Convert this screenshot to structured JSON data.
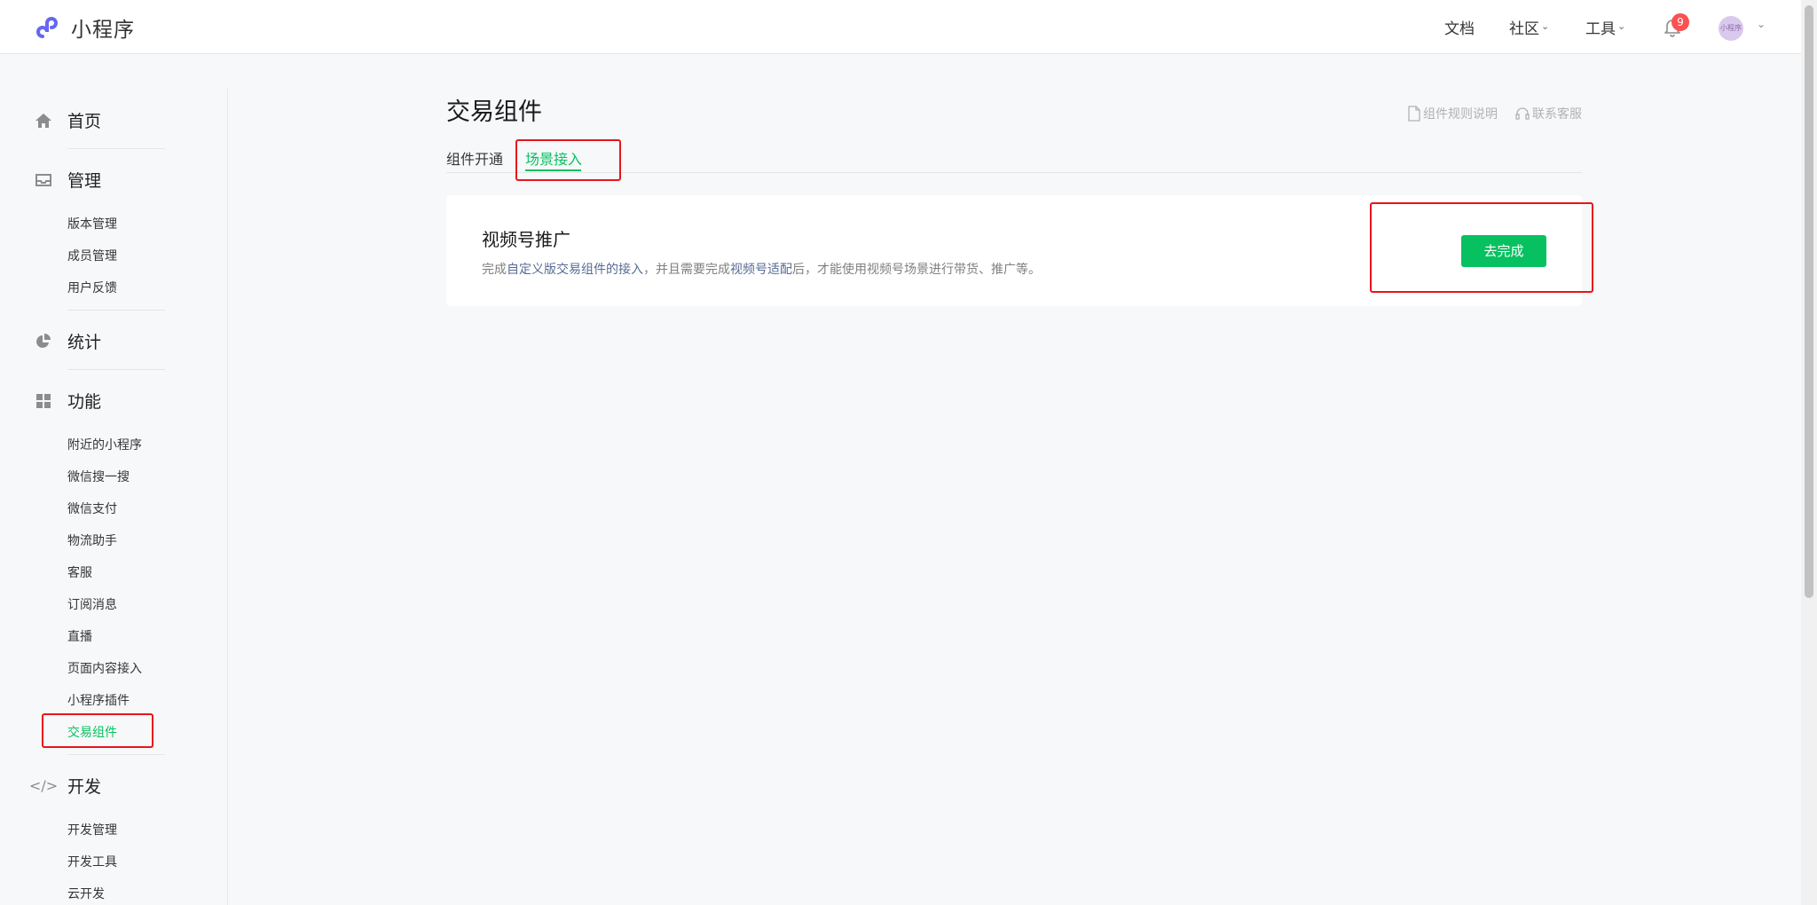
{
  "header": {
    "logo_text": "小程序",
    "nav": {
      "docs": "文档",
      "community": "社区",
      "tools": "工具"
    },
    "notification_count": "9",
    "avatar_text": "小程序"
  },
  "sidebar": {
    "home": "首页",
    "manage": {
      "label": "管理",
      "items": [
        "版本管理",
        "成员管理",
        "用户反馈"
      ]
    },
    "stats": "统计",
    "features": {
      "label": "功能",
      "items": [
        "附近的小程序",
        "微信搜一搜",
        "微信支付",
        "物流助手",
        "客服",
        "订阅消息",
        "直播",
        "页面内容接入",
        "小程序插件",
        "交易组件"
      ]
    },
    "develop": {
      "label": "开发",
      "items": [
        "开发管理",
        "开发工具",
        "云开发"
      ]
    }
  },
  "main": {
    "title": "交易组件",
    "links": {
      "rules": "组件规则说明",
      "support": "联系客服"
    },
    "tabs": [
      "组件开通",
      "场景接入"
    ],
    "card": {
      "title": "视频号推广",
      "desc_prefix": "完成",
      "desc_link1": "自定义版交易组件的接入",
      "desc_mid": "，并且需要完成",
      "desc_link2": "视频号适配",
      "desc_suffix": "后，才能使用视频号场景进行带货、推广等。",
      "button": "去完成"
    }
  },
  "colors": {
    "accent": "#07c160",
    "highlight": "#e8141d",
    "link": "#576b95",
    "badge": "#fa5151"
  }
}
